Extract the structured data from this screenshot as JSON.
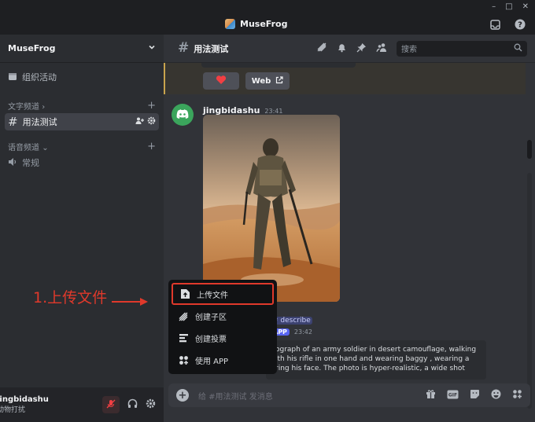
{
  "window": {
    "title": "MuseFrog",
    "controls": [
      "–",
      "□",
      "✕"
    ]
  },
  "sidebar": {
    "server_name": "MuseFrog",
    "events_label": "组织活动",
    "text_category": "文字频道",
    "active_channel": "用法测试",
    "voice_category": "语音频道",
    "voice_channel": "常规"
  },
  "user": {
    "name": "jingbidashu",
    "status": "动物打扰"
  },
  "header": {
    "channel": "用法测试",
    "search_placeholder": "搜索"
  },
  "prev_message": {
    "web_label": "Web"
  },
  "message": {
    "author": "jingbidashu",
    "time": "23:41",
    "mention": "# describe",
    "app_badge": "APP",
    "app_time": "23:42",
    "embed_lines": [
      "ograph of an army soldier in desert camouflage, walking",
      "ith his rifle in one hand and wearing baggy , wearing a",
      "ring his face. The photo is hyper-realistic, a wide shot"
    ]
  },
  "composer": {
    "placeholder": "给 #用法测试 发消息"
  },
  "upload_menu": {
    "items": [
      {
        "label": "上传文件",
        "icon": "upload-file-icon"
      },
      {
        "label": "创建子区",
        "icon": "thread-icon"
      },
      {
        "label": "创建投票",
        "icon": "poll-icon"
      },
      {
        "label": "使用 APP",
        "icon": "app-icon"
      }
    ]
  },
  "annotation": {
    "text": "1.上传文件"
  },
  "colors": {
    "accent": "#5865f2",
    "annotation": "#e0392b",
    "online": "#3ba55c"
  }
}
